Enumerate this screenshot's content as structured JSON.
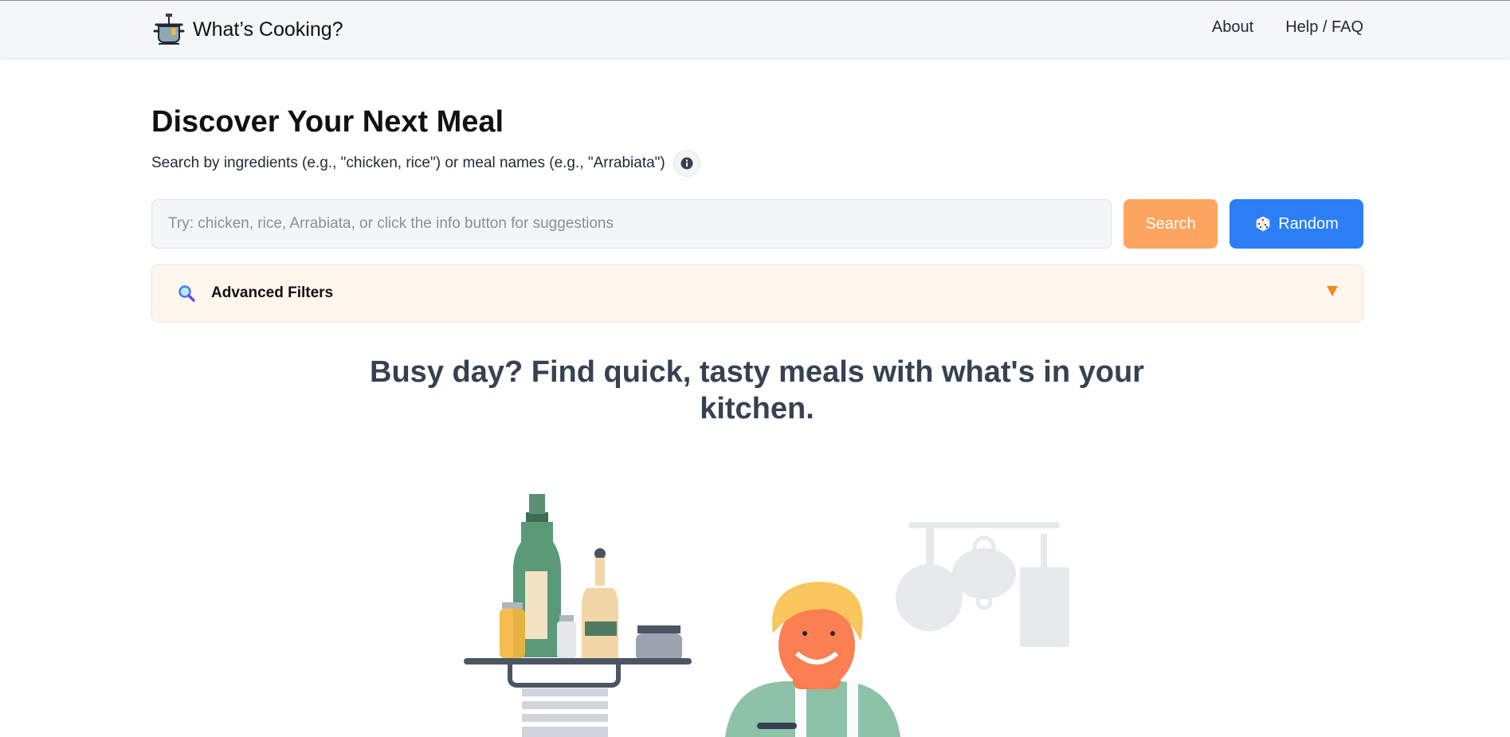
{
  "app": {
    "title": "What’s Cooking?",
    "logo_icon": "cooking-pot-icon"
  },
  "nav": {
    "links": [
      {
        "label": "About"
      },
      {
        "label": "Help / FAQ"
      }
    ]
  },
  "hero": {
    "title": "Discover Your Next Meal",
    "subtitle": "Search by ingredients (e.g., \"chicken, rice\") or meal names (e.g., \"Arrabiata\")",
    "info_icon": "info-icon"
  },
  "search": {
    "value": "",
    "placeholder": "Try: chicken, rice, Arrabiata, or click the info button for suggestions",
    "search_label": "Search",
    "random_label": "Random",
    "random_icon": "dice-icon"
  },
  "filters": {
    "label": "Advanced Filters",
    "icon": "magnifier-icon",
    "toggle_icon": "triangle-down-icon"
  },
  "tagline": "Busy day? Find quick, tasty meals with what's in your kitchen.",
  "colors": {
    "search_button": "#fda460",
    "random_button": "#2b7ef6",
    "filters_bg": "#fff6ee",
    "filter_arrow": "#f28c1c",
    "navbar_bg": "#f4f6f7"
  }
}
